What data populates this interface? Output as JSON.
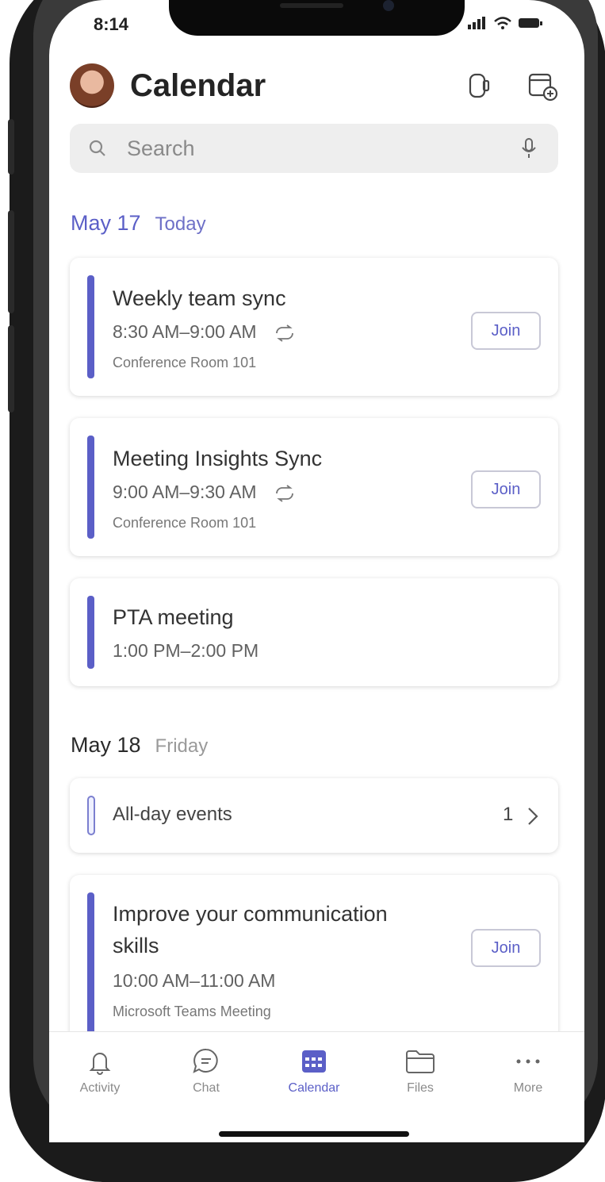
{
  "status": {
    "time": "8:14",
    "indicators": "signal-wifi-battery"
  },
  "header": {
    "title": "Calendar",
    "avatar": "profile-photo",
    "icons": [
      "meet-now-icon",
      "new-event-icon"
    ]
  },
  "search": {
    "placeholder": "Search"
  },
  "days": [
    {
      "date": "May 17",
      "label": "Today"
    },
    {
      "date": "May 18",
      "label": "Friday"
    }
  ],
  "events_day1": [
    {
      "title": "Weekly team sync",
      "time": "8:30 AM–9:00 AM",
      "location": "Conference Room 101",
      "join": "Join",
      "recurring": true
    },
    {
      "title": "Meeting Insights Sync",
      "time": "9:00 AM–9:30 AM",
      "location": "Conference Room 101",
      "join": "Join",
      "recurring": true
    },
    {
      "title": "PTA meeting",
      "time": "1:00 PM–2:00 PM"
    }
  ],
  "allday": {
    "label": "All-day events",
    "count": "1"
  },
  "events_day2": [
    {
      "title_line1": "Improve your communication",
      "title_line2": "skills",
      "time": "10:00 AM–11:00 AM",
      "location": "Microsoft Teams Meeting",
      "join": "Join"
    }
  ],
  "tabs": [
    {
      "label": "Activity",
      "icon": "bell-icon"
    },
    {
      "label": "Chat",
      "icon": "chat-icon"
    },
    {
      "label": "Calendar",
      "icon": "calendar-icon",
      "active": true
    },
    {
      "label": "Files",
      "icon": "folder-icon"
    },
    {
      "label": "More",
      "icon": "more-icon"
    }
  ],
  "colors": {
    "accent": "#5b5fc7",
    "text": "#242424",
    "muted": "#8a8a8a"
  }
}
